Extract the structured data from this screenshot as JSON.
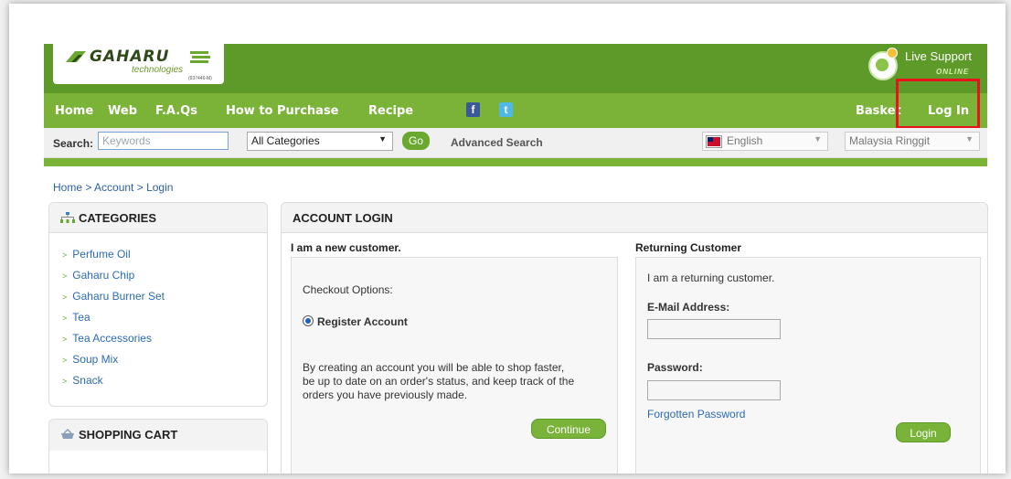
{
  "brand": {
    "name": "GAHARU",
    "tagline": "technologies",
    "reg": "(937446-M)"
  },
  "live_support": {
    "title": "Live Support",
    "status": "ONLINE"
  },
  "nav": {
    "items": [
      "Home",
      "Web",
      "F.A.Qs",
      "How to Purchase",
      "Recipe"
    ],
    "facebook": "f",
    "twitter": "t",
    "basket": "Basket",
    "login": "Log In"
  },
  "search": {
    "label": "Search:",
    "placeholder": "Keywords",
    "category": "All Categories",
    "go": "Go",
    "advanced": "Advanced Search",
    "language": "English",
    "currency": "Malaysia Ringgit"
  },
  "breadcrumb": [
    "Home",
    "Account",
    "Login"
  ],
  "breadcrumb_sep": " > ",
  "categories": {
    "title": "CATEGORIES",
    "items": [
      "Perfume Oil",
      "Gaharu Chip",
      "Gaharu Burner Set",
      "Tea",
      "Tea Accessories",
      "Soup Mix",
      "Snack"
    ]
  },
  "shopping_cart": {
    "title": "SHOPPING CART"
  },
  "account_login": {
    "title": "ACCOUNT LOGIN",
    "new_customer": {
      "heading": "I am a new customer.",
      "checkout_options": "Checkout Options:",
      "register": "Register Account",
      "description_lines": [
        "By creating an account you will be able to shop faster,",
        "be up to date on an order's status, and keep track of the",
        "orders you have previously made."
      ],
      "continue": "Continue"
    },
    "returning_customer": {
      "heading": "Returning Customer",
      "intro": "I am a returning customer.",
      "email_label": "E-Mail Address:",
      "password_label": "Password:",
      "forgotten": "Forgotten Password",
      "login": "Login"
    }
  },
  "colors": {
    "header_green": "#5d9a2a",
    "nav_green": "#7ab337",
    "highlight_red": "#e8131b",
    "link_blue": "#2b6bb5"
  }
}
